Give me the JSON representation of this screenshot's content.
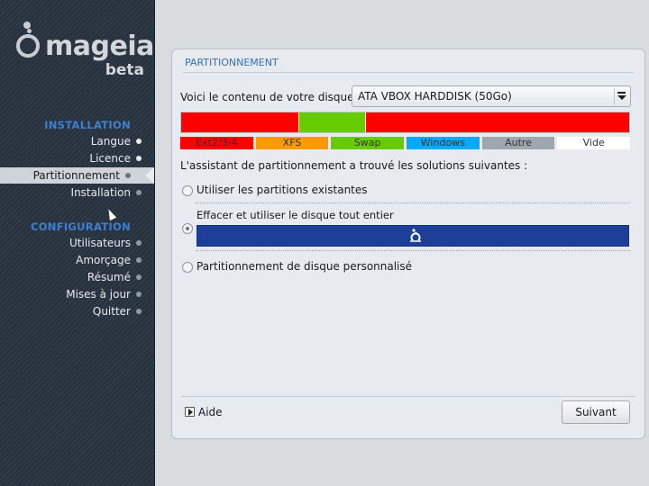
{
  "sidebar": {
    "logo_text": "mageia",
    "logo_sub": "beta",
    "installation_title": "INSTALLATION",
    "configuration_title": "CONFIGURATION",
    "installation_steps": [
      {
        "label": "Langue",
        "state": "done"
      },
      {
        "label": "Licence",
        "state": "done"
      },
      {
        "label": "Partitionnement",
        "state": "current"
      },
      {
        "label": "Installation",
        "state": "pending"
      }
    ],
    "configuration_steps": [
      {
        "label": "Utilisateurs",
        "state": "pending"
      },
      {
        "label": "Amorçage",
        "state": "pending"
      },
      {
        "label": "Résumé",
        "state": "pending"
      },
      {
        "label": "Mises à jour",
        "state": "pending"
      },
      {
        "label": "Quitter",
        "state": "pending"
      }
    ]
  },
  "panel": {
    "title": "PARTITIONNEMENT",
    "disk_label": "Voici le contenu de votre disque",
    "disk_value": "ATA VBOX HARDDISK (50Go)",
    "partitions": [
      {
        "color": "#ff0000",
        "fraction": 0.262
      },
      {
        "color": "#66cc00",
        "fraction": 0.148
      },
      {
        "color": "#ff0000",
        "fraction": 0.59
      }
    ],
    "legend": [
      {
        "label": "Ext2/3/4",
        "color": "#ff0000"
      },
      {
        "label": "XFS",
        "color": "#ff9900"
      },
      {
        "label": "Swap",
        "color": "#66cc00"
      },
      {
        "label": "Windows",
        "color": "#00aaff"
      },
      {
        "label": "Autre",
        "color": "#9ea6ae"
      },
      {
        "label": "Vide",
        "color": "#ffffff"
      }
    ],
    "assistant_text": "L'assistant de partitionnement a trouvé les solutions suivantes :",
    "options": {
      "existing": "Utiliser les partitions existantes",
      "erase": "Effacer et utiliser le disque tout entier",
      "custom": "Partitionnement de disque personnalisé"
    },
    "selected_option": "erase",
    "erase_bar_color": "#1e3f97",
    "help_label": "Aide",
    "next_label": "Suivant"
  },
  "colors": {
    "accent": "#3d7fd0"
  }
}
